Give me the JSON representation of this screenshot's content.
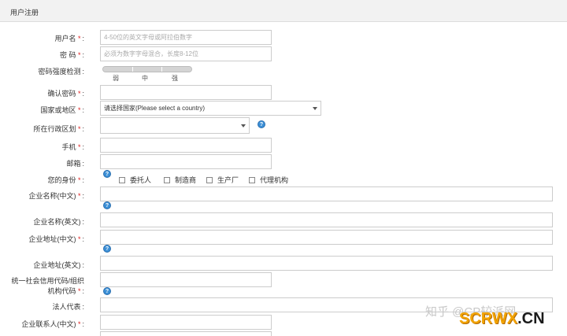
{
  "header": {
    "title": "用户注册"
  },
  "form": {
    "username": {
      "label": "用户名",
      "required": "*",
      "placeholder": "4-50位的英文字母或阿拉伯数字"
    },
    "password": {
      "label": "密 码",
      "required": "*",
      "placeholder": "必须为数字字母混合，长度8-12位"
    },
    "strength": {
      "label": "密码强度检测",
      "levels": [
        "弱",
        "中",
        "强"
      ]
    },
    "confirm": {
      "label": "确认密码",
      "required": "*"
    },
    "country": {
      "label": "国家或地区",
      "required": "*",
      "value": "请选择国家(Please select a country)"
    },
    "region": {
      "label": "所在行政区划",
      "required": "*"
    },
    "phone": {
      "label": "手机",
      "required": "*"
    },
    "email": {
      "label": "邮箱"
    },
    "identity": {
      "label": "您的身份",
      "required": "*",
      "options": [
        "委托人",
        "制造商",
        "生产厂",
        "代理机构"
      ]
    },
    "company_cn": {
      "label": "企业名称(中文)",
      "required": "*"
    },
    "company_en": {
      "label": "企业名称(英文)"
    },
    "address_cn": {
      "label": "企业地址(中文)",
      "required": "*"
    },
    "address_en": {
      "label": "企业地址(英文)"
    },
    "credit_code": {
      "label_line1": "统一社会信用代码/组织",
      "label_line2": "机构代码",
      "required": "*"
    },
    "legal_rep": {
      "label": "法人代表"
    },
    "contact_cn": {
      "label": "企业联系人(中文)",
      "required": "*"
    }
  },
  "icons": {
    "help": "question-circle-icon"
  },
  "watermark": {
    "zhihu": "知乎 @CP较派网",
    "brand_main": "SCRWX",
    "brand_suffix": ".CN"
  },
  "colors": {
    "required": "#e02020",
    "help": "#3b8fd6",
    "header_bg": "#f2f2f2",
    "brand": "#f2a300"
  }
}
